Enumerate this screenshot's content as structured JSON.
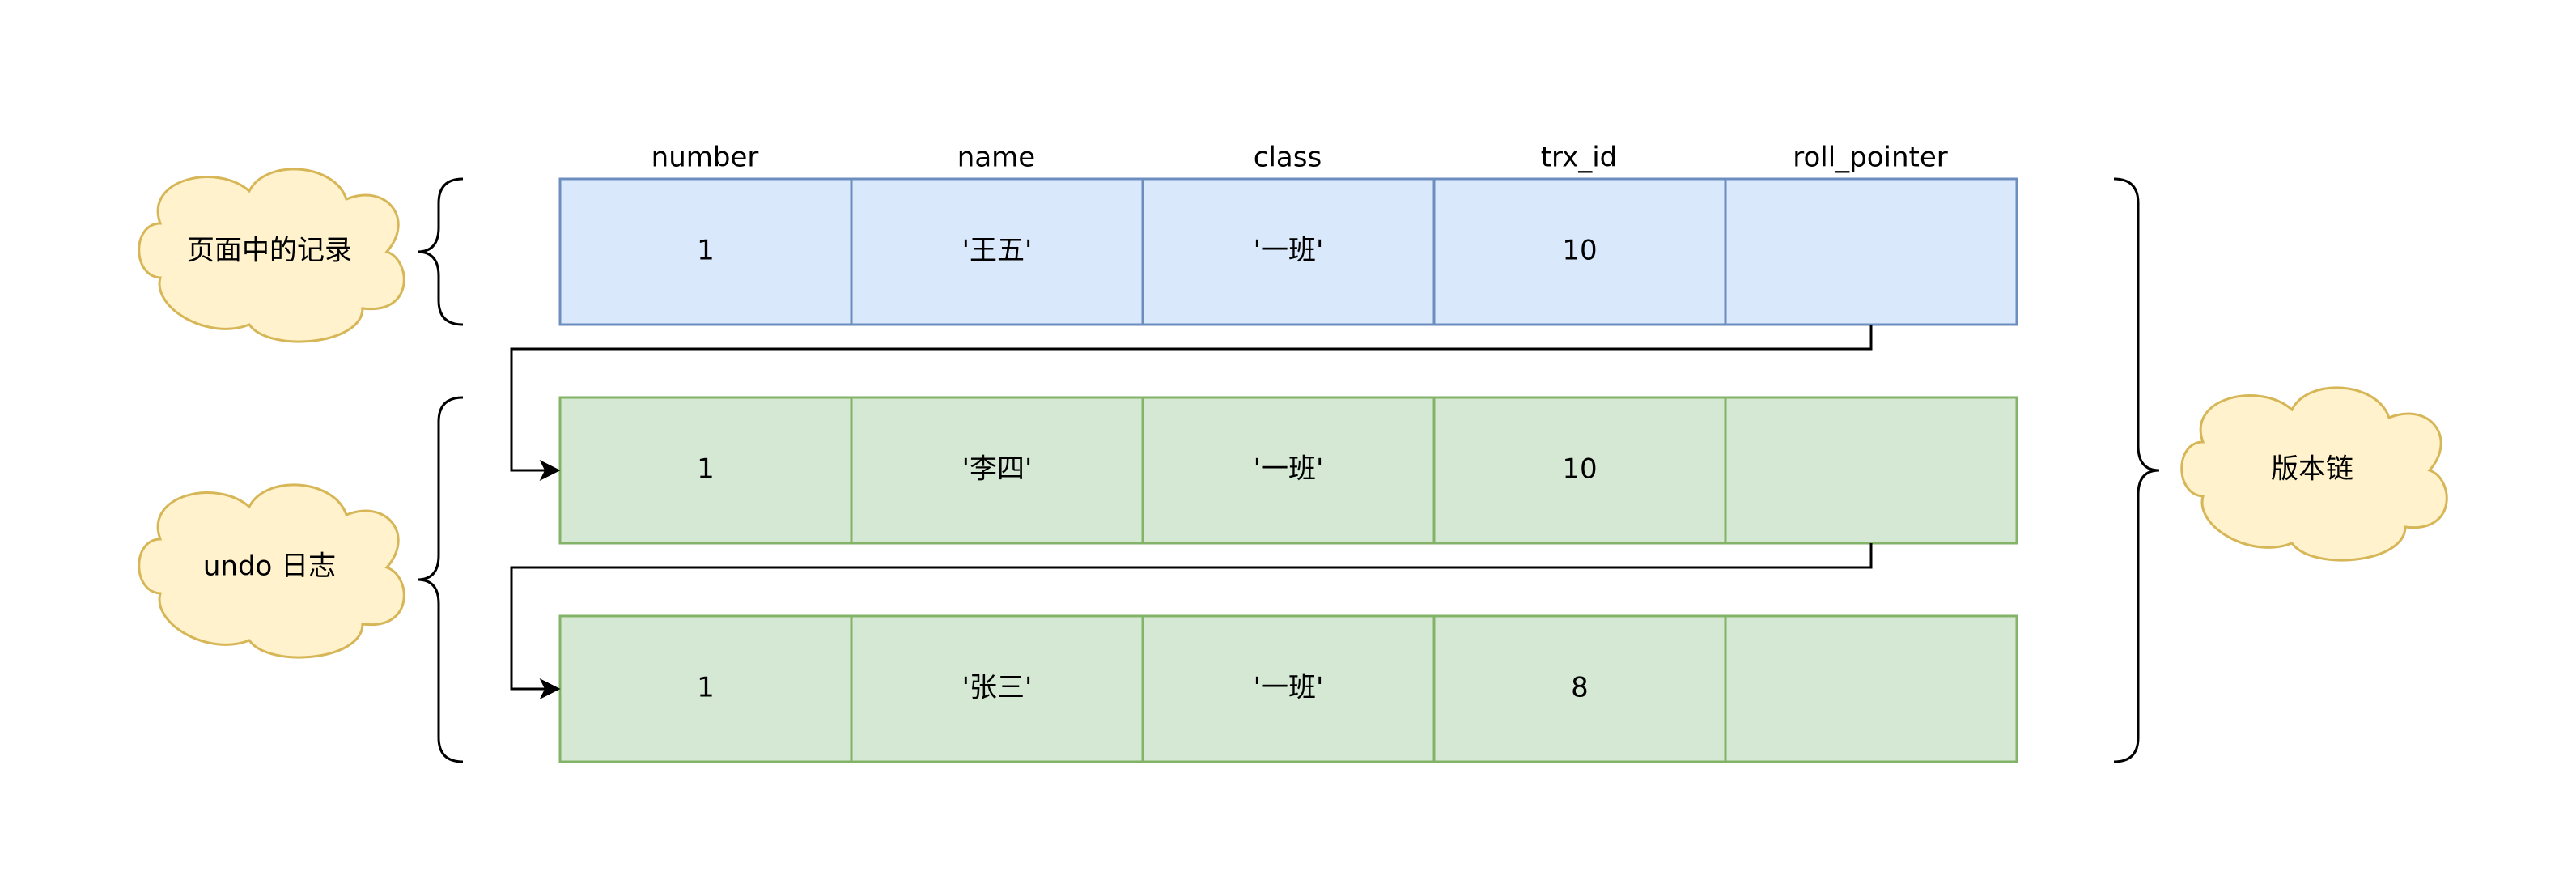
{
  "columns": [
    "number",
    "name",
    "class",
    "trx_id",
    "roll_pointer"
  ],
  "rows": [
    {
      "kind": "page",
      "cells": [
        "1",
        "'王五'",
        "'一班'",
        "10",
        ""
      ]
    },
    {
      "kind": "undo",
      "cells": [
        "1",
        "'李四'",
        "'一班'",
        "10",
        ""
      ]
    },
    {
      "kind": "undo",
      "cells": [
        "1",
        "'张三'",
        "'一班'",
        "8",
        ""
      ]
    }
  ],
  "labels": {
    "page_record": "页面中的记录",
    "undo_log": "undo 日志",
    "version_chain": "版本链"
  },
  "colors": {
    "page_fill": "#dae8fc",
    "page_stroke": "#6c8ebf",
    "undo_fill": "#d5e8d4",
    "undo_stroke": "#82b366",
    "cloud_fill": "#fff2cc",
    "cloud_stroke": "#d6b656",
    "line": "#000000"
  }
}
